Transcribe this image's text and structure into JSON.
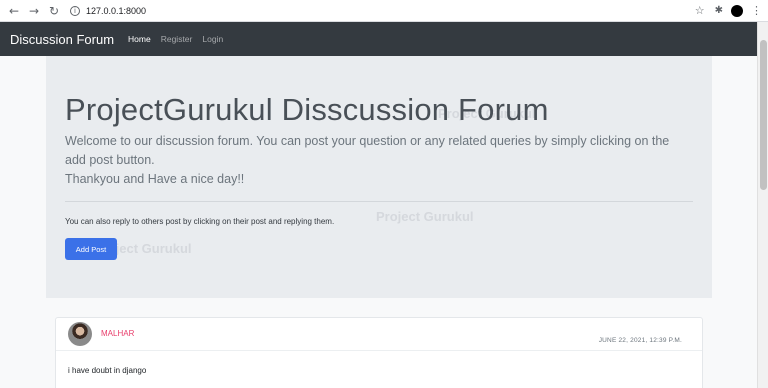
{
  "browser": {
    "url": "127.0.0.1:8000"
  },
  "navbar": {
    "brand": "Discussion Forum",
    "links": [
      {
        "label": "Home",
        "active": true
      },
      {
        "label": "Register",
        "active": false
      },
      {
        "label": "Login",
        "active": false
      }
    ]
  },
  "jumbotron": {
    "title": "ProjectGurukul Disscussion Forum",
    "lead_line1": "Welcome to our discussion forum. You can post your question or any related queries by simply clicking on the add post button.",
    "lead_line2": "Thankyou and Have a nice day!!",
    "note": "You can also reply to others post by clicking on their post and replying them.",
    "add_button": "Add Post"
  },
  "watermark": {
    "text": "Project Gurukul"
  },
  "posts": [
    {
      "username": "MALHAR",
      "timestamp": "JUNE 22, 2021, 12:39 P.M.",
      "content": "i have doubt in django"
    }
  ],
  "colors": {
    "navbar_bg": "#343a40",
    "button_primary": "#3b71e8",
    "username": "#e83e6c"
  }
}
